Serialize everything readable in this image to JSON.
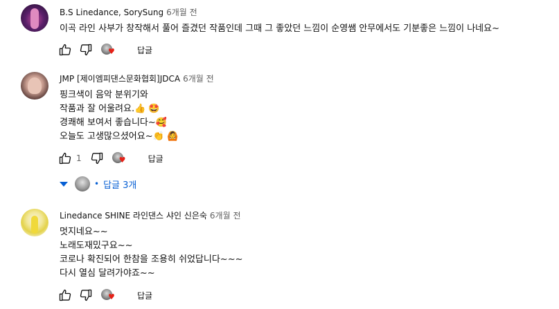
{
  "comments": [
    {
      "author": "B.S Linedance, SorySung",
      "time": "6개월 전",
      "lines": [
        "이곡 라인 사부가 창작해서 풀어 즐겼던 작품인데 그때 그 좋았던 느낌이 순영쌤 안무에서도 기분좋은 느낌이 나네요~"
      ],
      "like_count": "",
      "reply_label": "답글"
    },
    {
      "author": "JMP [제이엠피댄스문화협회]JDCA",
      "time": "6개월 전",
      "lines": [
        "핑크색이 음악 분위기와",
        "작품과 잘 어울려요.",
        "경쾌해 보여서 좋습니다~",
        "오늘도 고생많으셨어요~"
      ],
      "emoji": [
        "👍 🤩",
        "🥰",
        "👏 🙆"
      ],
      "like_count": "1",
      "reply_label": "답글",
      "replies_toggle": {
        "label": "답글 3개",
        "dot": "•"
      }
    },
    {
      "author": "Linedance SHINE 라인댄스 샤인 신은숙",
      "time": "6개월 전",
      "lines": [
        "멋지네요~~",
        "노래도재밌구요~~",
        "코로나 확진되어 한참을 조용히 쉬었답니다~~~",
        "다시 열심 달려가야죠~~"
      ],
      "like_count": "",
      "reply_label": "답글"
    }
  ],
  "icons": {
    "like": "thumb-up-icon",
    "dislike": "thumb-down-icon",
    "creator_heart": "creator-heart-icon",
    "expand": "caret-down-icon"
  },
  "colors": {
    "link_blue": "#065fd4",
    "heart_red": "#e62117",
    "secondary_text": "#606060"
  }
}
